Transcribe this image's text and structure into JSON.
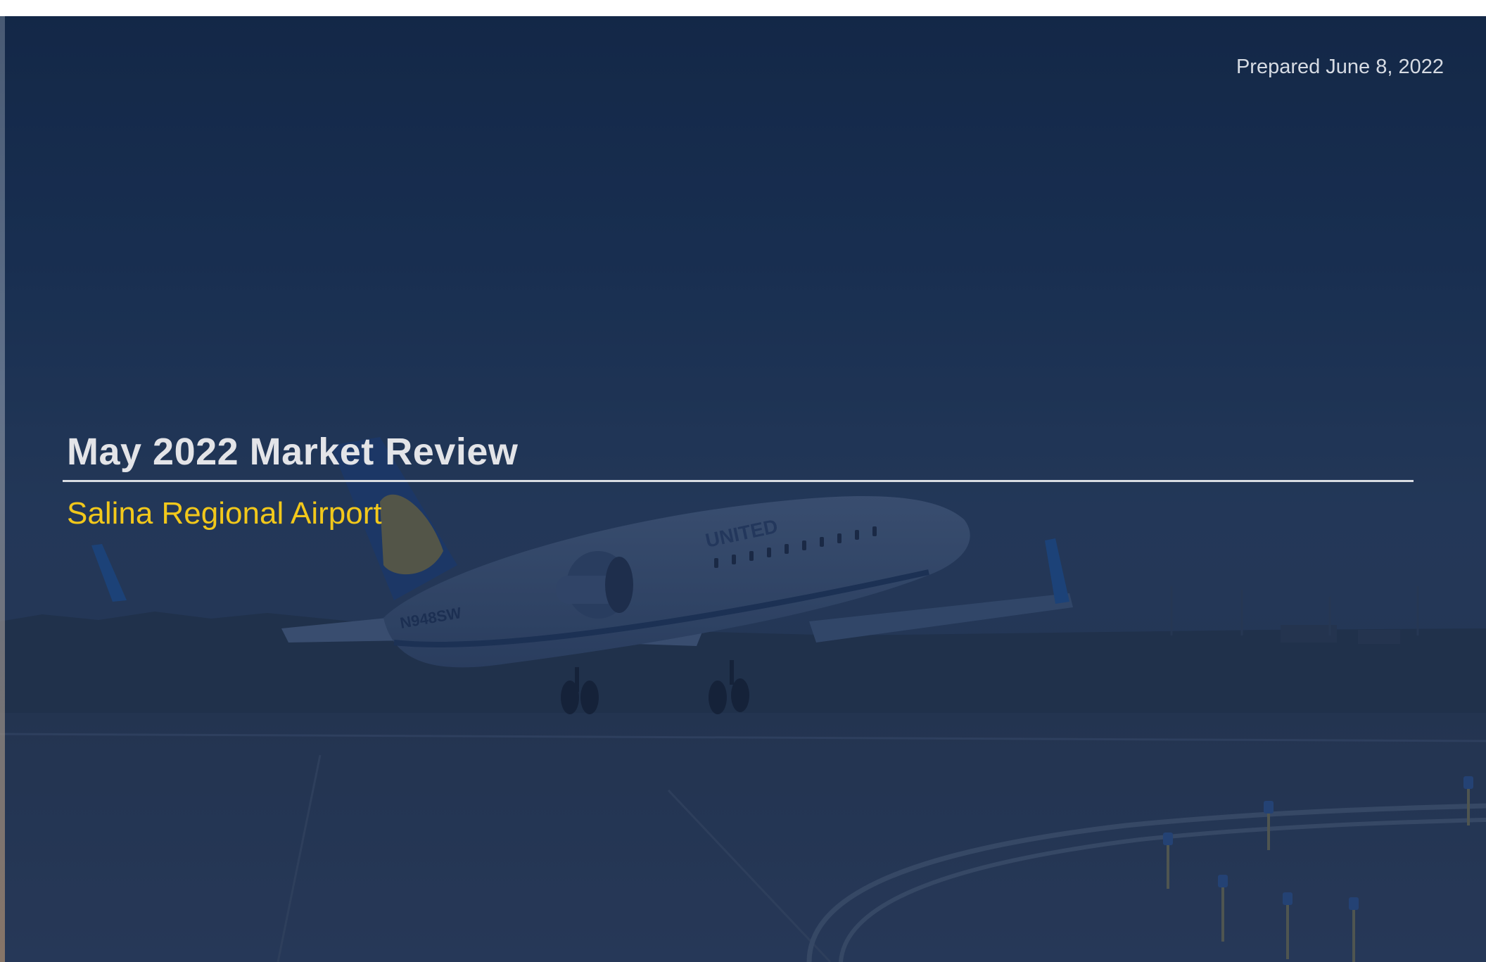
{
  "slide": {
    "prepared_date": "Prepared June 8, 2022",
    "title": "May 2022 Market Review",
    "subtitle": "Salina Regional Airport"
  },
  "background_photo": {
    "aircraft_livery": "UNITED",
    "aircraft_registration": "N948SW"
  },
  "colors": {
    "overlay_navy": "#1b3356",
    "title_text": "#e3e4e8",
    "subtitle_gold": "#f2c81b",
    "rule": "#d9dce2"
  }
}
